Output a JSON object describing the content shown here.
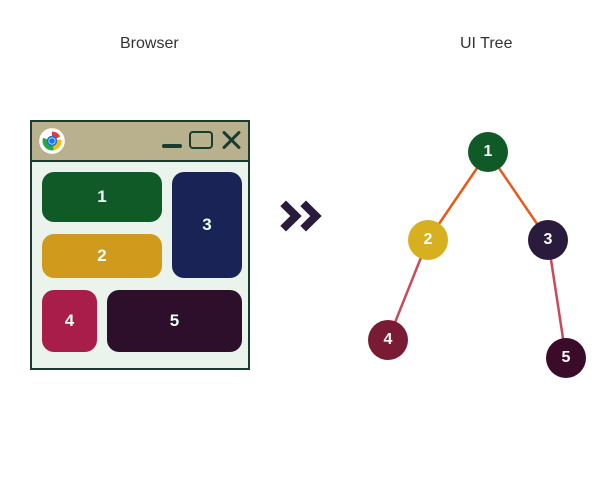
{
  "titles": {
    "browser": "Browser",
    "tree": "UI Tree"
  },
  "blocks": {
    "b1": {
      "label": "1",
      "color": "#0f5a27"
    },
    "b2": {
      "label": "2",
      "color": "#d09a1d"
    },
    "b3": {
      "label": "3",
      "color": "#1a2355"
    },
    "b4": {
      "label": "4",
      "color": "#a81d49"
    },
    "b5": {
      "label": "5",
      "color": "#2d0f2b"
    }
  },
  "tree": {
    "nodes": {
      "n1": {
        "label": "1",
        "color": "#0f5a27"
      },
      "n2": {
        "label": "2",
        "color": "#d6b01f"
      },
      "n3": {
        "label": "3",
        "color": "#2a1b3d"
      },
      "n4": {
        "label": "4",
        "color": "#7a1b36"
      },
      "n5": {
        "label": "5",
        "color": "#3a0c29"
      }
    },
    "edges": [
      {
        "from": "n1",
        "to": "n2"
      },
      {
        "from": "n1",
        "to": "n3"
      },
      {
        "from": "n2",
        "to": "n4"
      },
      {
        "from": "n3",
        "to": "n5"
      }
    ],
    "edge_color": "#e85a1a"
  },
  "icons": {
    "chrome": "chrome-icon",
    "minimize": "minimize-icon",
    "maximize": "maximize-icon",
    "close": "close-icon"
  }
}
